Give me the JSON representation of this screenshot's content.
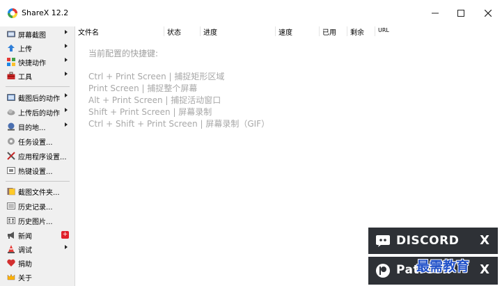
{
  "window": {
    "title": "ShareX 12.2"
  },
  "sidebar": {
    "items": [
      {
        "label": "屏幕截图",
        "icon": "screenshot-icon",
        "has_arrow": true
      },
      {
        "label": "上传",
        "icon": "upload-arrow-icon",
        "has_arrow": true
      },
      {
        "label": "快捷动作",
        "icon": "quick-actions-grid-icon",
        "has_arrow": true
      },
      {
        "label": "工具",
        "icon": "toolbox-icon",
        "has_arrow": true
      },
      {
        "label": "截图后的动作",
        "icon": "after-capture-icon",
        "has_arrow": true
      },
      {
        "label": "上传后的动作",
        "icon": "after-upload-cloud-icon",
        "has_arrow": true
      },
      {
        "label": "目的地...",
        "icon": "destinations-globe-icon",
        "has_arrow": true
      },
      {
        "label": "任务设置...",
        "icon": "task-settings-gear-icon",
        "has_arrow": false
      },
      {
        "label": "应用程序设置...",
        "icon": "app-settings-tools-icon",
        "has_arrow": false
      },
      {
        "label": "热键设置...",
        "icon": "hotkey-keyboard-icon",
        "has_arrow": false
      },
      {
        "label": "截图文件夹...",
        "icon": "folder-icon",
        "has_arrow": false
      },
      {
        "label": "历史记录...",
        "icon": "history-icon",
        "has_arrow": false
      },
      {
        "label": "历史图片...",
        "icon": "image-history-icon",
        "has_arrow": false
      },
      {
        "label": "新闻",
        "icon": "megaphone-icon",
        "has_arrow": false,
        "badge": "+"
      },
      {
        "label": "调试",
        "icon": "debug-cone-icon",
        "has_arrow": true
      },
      {
        "label": "捐助",
        "icon": "heart-icon",
        "has_arrow": false
      },
      {
        "label": "关于",
        "icon": "about-crown-icon",
        "has_arrow": false
      }
    ]
  },
  "table": {
    "columns": [
      "文件名",
      "状态",
      "进度",
      "速度",
      "已用",
      "剩余",
      "URL"
    ]
  },
  "hotkeys": {
    "title": "当前配置的快捷键:",
    "lines": [
      "Ctrl + Print Screen  |  捕捉矩形区域",
      "Print Screen  |  捕捉整个屏幕",
      "Alt + Print Screen  |  捕捉活动窗口",
      "Shift + Print Screen  |  屏幕录制",
      "Ctrl + Shift + Print Screen  |  屏幕录制（GIF）"
    ]
  },
  "promos": {
    "discord": "DISCORD",
    "patreon": "Patreon",
    "close": "X"
  },
  "watermark": "最需教育",
  "colors": {
    "promo_bg": "#2e3136",
    "hint_text": "#a8a8a8",
    "news_badge": "#e0202a"
  }
}
